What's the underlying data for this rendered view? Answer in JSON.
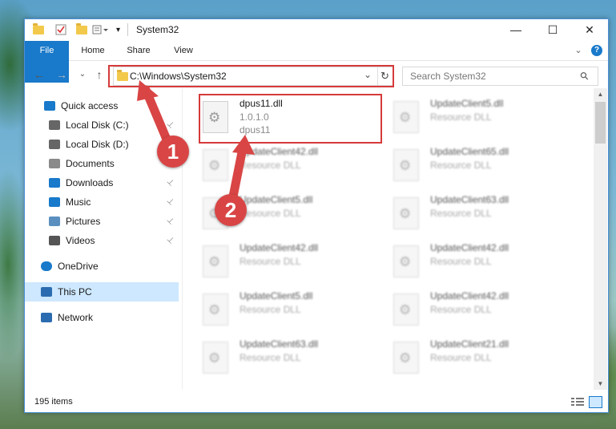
{
  "window": {
    "title": "System32",
    "minimize_glyph": "—",
    "maximize_glyph": "☐",
    "close_glyph": "✕",
    "help_glyph": "?",
    "chevron_glyph": "⌄"
  },
  "ribbon": {
    "file": "File",
    "home": "Home",
    "share": "Share",
    "view": "View"
  },
  "nav": {
    "back_glyph": "←",
    "forward_glyph": "→",
    "recent_glyph": "⌄",
    "up_glyph": "↑",
    "refresh_glyph": "↻",
    "address": "C:\\Windows\\System32",
    "search_placeholder": "Search System32",
    "search_icon_glyph": "⚲"
  },
  "sidebar": {
    "items": [
      {
        "label": "Quick access",
        "icon": "star-icon"
      },
      {
        "label": "Local Disk (C:)",
        "icon": "drive-icon",
        "pinned": true
      },
      {
        "label": "Local Disk (D:)",
        "icon": "drive-icon"
      },
      {
        "label": "Documents",
        "icon": "documents-icon",
        "pinned": true
      },
      {
        "label": "Downloads",
        "icon": "download-icon",
        "pinned": true
      },
      {
        "label": "Music",
        "icon": "music-icon",
        "pinned": true
      },
      {
        "label": "Pictures",
        "icon": "pictures-icon",
        "pinned": true
      },
      {
        "label": "Videos",
        "icon": "videos-icon",
        "pinned": true
      },
      {
        "label": "OneDrive",
        "icon": "cloud-icon"
      },
      {
        "label": "This PC",
        "icon": "computer-icon",
        "selected": true
      },
      {
        "label": "Network",
        "icon": "network-icon"
      }
    ],
    "pin_glyph": "📌"
  },
  "files": [
    {
      "name": "dpus11.dll",
      "line2": "1.0.1.0",
      "line3": "dpus11",
      "highlighted": true
    },
    {
      "name": "UpdateClient5.dll",
      "line2": "Resource DLL"
    },
    {
      "name": "UpdateClient42.dll",
      "line2": "Resource DLL"
    },
    {
      "name": "UpdateClient65.dll",
      "line2": "Resource DLL"
    },
    {
      "name": "UpdateClient5.dll",
      "line2": "Resource DLL"
    },
    {
      "name": "UpdateClient63.dll",
      "line2": "Resource DLL"
    },
    {
      "name": "UpdateClient42.dll",
      "line2": "Resource DLL"
    },
    {
      "name": "UpdateClient42.dll",
      "line2": "Resource DLL"
    },
    {
      "name": "UpdateClient5.dll",
      "line2": "Resource DLL"
    },
    {
      "name": "UpdateClient42.dll",
      "line2": "Resource DLL"
    },
    {
      "name": "UpdateClient63.dll",
      "line2": "Resource DLL"
    },
    {
      "name": "UpdateClient21.dll",
      "line2": "Resource DLL"
    }
  ],
  "status": {
    "items": "195 items"
  },
  "annotations": {
    "step1": "1",
    "step2": "2"
  },
  "colors": {
    "accent": "#1979ca",
    "highlight": "#d63a3a",
    "marker": "#d94545"
  }
}
